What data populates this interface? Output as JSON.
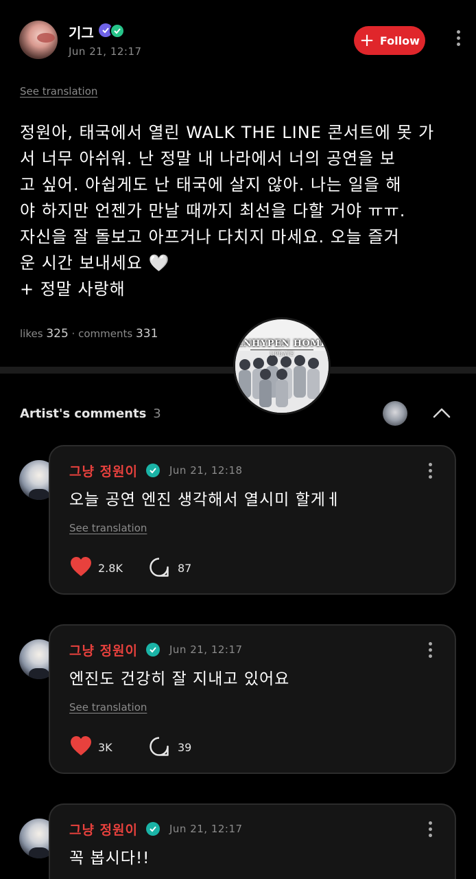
{
  "post": {
    "username": "기그",
    "date": "Jun 21, 12:17",
    "follow_label": "Follow",
    "see_translation": "See translation",
    "body": "정원아, 태국에서 열린 WALK THE LINE 콘서트에 못 가\n서 너무 아쉬워. 난 정말 내 나라에서 너의 공연을 보\n고 싶어. 아쉽게도 난 태국에 살지 않아. 나는 일을 해\n야 하지만 언젠가 만날 때까지 최선을 다할 거야 ㅠㅠ.\n자신을 잘 돌보고 아프거나 다치지 마세요. 오늘 즐거\n운 시간 보내세요 🤍\n+ 정말 사랑해",
    "likes_label": "likes",
    "likes": "325",
    "comments_label": "comments",
    "comments": "331"
  },
  "watermark": {
    "title": "ENHYPEN HOME",
    "subtitle": "UPDATE"
  },
  "artist_comments": {
    "label": "Artist's comments",
    "count": "3",
    "items": [
      {
        "name": "그냥 정원이",
        "date": "Jun 21, 12:18",
        "text": "오늘 공연 엔진 생각해서 열시미 할게ㅔ",
        "see_translation": "See translation",
        "likes": "2.8K",
        "replies": "87"
      },
      {
        "name": "그냥 정원이",
        "date": "Jun 21, 12:17",
        "text": "엔진도 건강히 잘 지내고 있어요",
        "see_translation": "See translation",
        "likes": "3K",
        "replies": "39"
      },
      {
        "name": "그냥 정원이",
        "date": "Jun 21, 12:17",
        "text": "꼭 봅시다!!"
      }
    ]
  },
  "colors": {
    "background": "#000000",
    "follow_button": "#e0262b",
    "artist_name": "#e8413d",
    "like_heart": "#e8413d",
    "verified_badge": "#1ab3a6"
  }
}
